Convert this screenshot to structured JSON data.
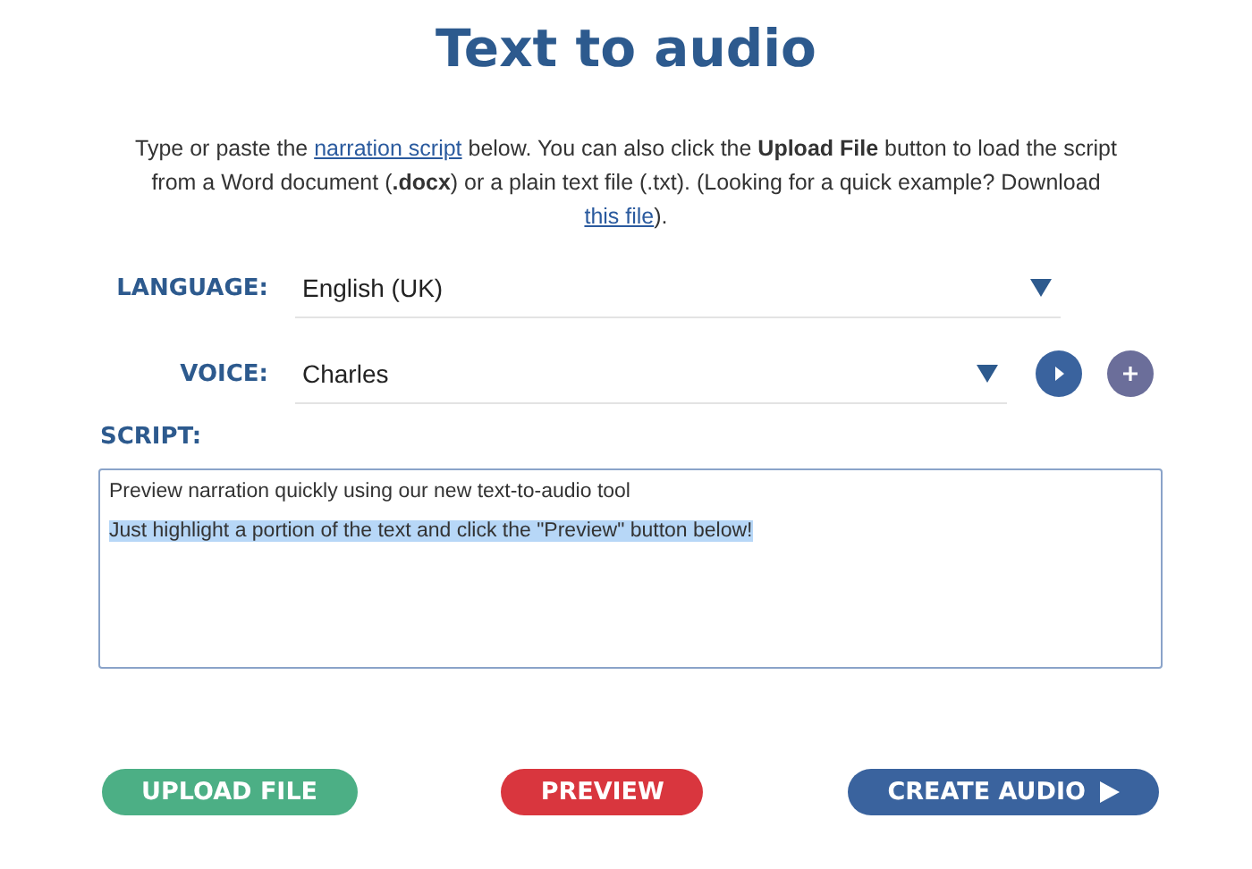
{
  "title": "Text to audio",
  "intro": [
    {
      "kind": "text",
      "text": "Type or paste the "
    },
    {
      "kind": "link",
      "text": "narration script"
    },
    {
      "kind": "text",
      "text": " below. You can also click the **Upload File** button to load the script from a Word document (**.docx**) or a plain text file (.txt). (Looking for a quick example? Download "
    },
    {
      "kind": "link",
      "text": "this file"
    },
    {
      "kind": "text",
      "text": ")."
    }
  ],
  "fields": [
    {
      "label": "LANGUAGE:",
      "value": "English (UK)",
      "extras": false
    },
    {
      "label": "VOICE:",
      "value": "Charles",
      "extras": true
    }
  ],
  "script": {
    "label": "SCRIPT:",
    "lines": [
      {
        "text": "Preview narration quickly using our new text-to-audio tool",
        "selected": false
      },
      {
        "text": "Just highlight a portion of the text and click the \"Preview\" button below!",
        "selected": true
      }
    ]
  },
  "buttons": [
    {
      "label": "UPLOAD FILE",
      "color": "#4caf85",
      "kind": "plain"
    },
    {
      "label": "PREVIEW",
      "color": "#d9363e",
      "kind": "plain"
    },
    {
      "label": "CREATE AUDIO",
      "color": "#3a639e",
      "kind": "play"
    }
  ]
}
